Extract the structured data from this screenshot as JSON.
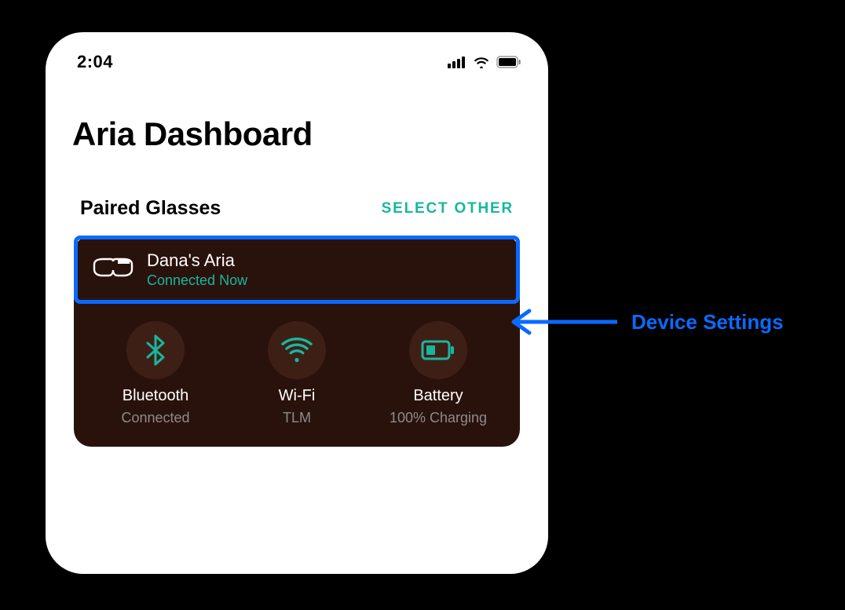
{
  "statusbar": {
    "time": "2:04"
  },
  "header": {
    "title": "Aria Dashboard"
  },
  "paired": {
    "section_label": "Paired Glasses",
    "select_other": "SELECT OTHER"
  },
  "device": {
    "name": "Dana's Aria",
    "status": "Connected Now",
    "tiles": {
      "bluetooth": {
        "label": "Bluetooth",
        "value": "Connected"
      },
      "wifi": {
        "label": "Wi-Fi",
        "value": "TLM"
      },
      "battery": {
        "label": "Battery",
        "value": "100% Charging"
      }
    }
  },
  "annotation": {
    "label": "Device Settings"
  },
  "colors": {
    "accent_teal": "#18b79d",
    "annotation_blue": "#0a6aff",
    "card_bg": "#2a120c",
    "tile_bg": "#3e1f16"
  }
}
